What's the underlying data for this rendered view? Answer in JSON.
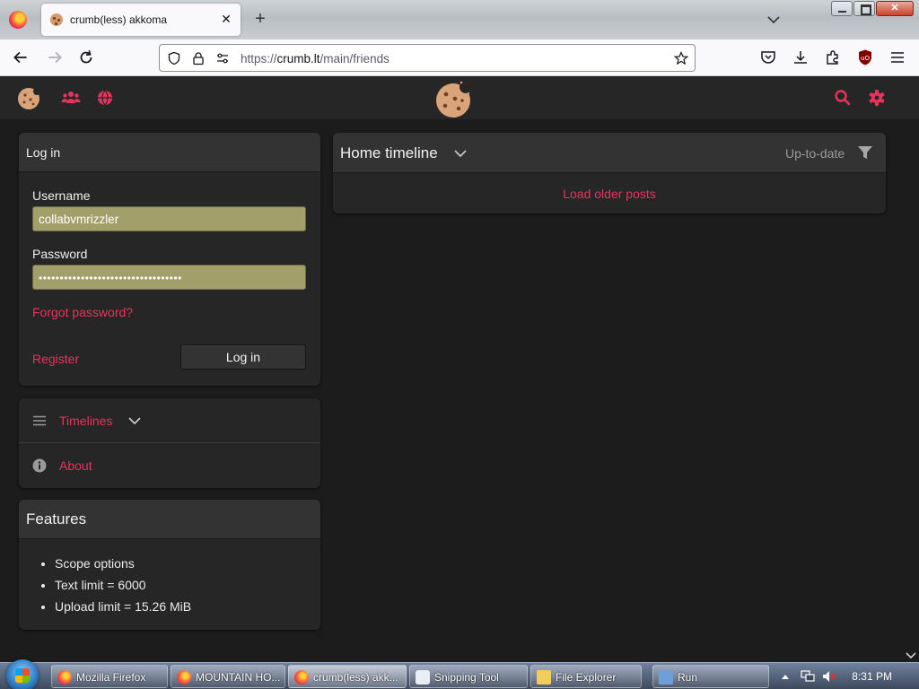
{
  "browser": {
    "tab_title": "crumb(less) akkoma",
    "url_prefix": "https://",
    "url_host": "crumb.lt",
    "url_path": "/main/friends"
  },
  "colors": {
    "accent": "#e8335d",
    "panel_bg": "#262626",
    "page_bg": "#1c1c1c",
    "field_bg": "#a39f6a"
  },
  "login": {
    "header": "Log in",
    "username_label": "Username",
    "username_value": "collabvmrizzler",
    "password_label": "Password",
    "password_value": "••••••••••••••••••••••••••••••••••",
    "forgot_link": "Forgot password?",
    "register_link": "Register",
    "login_button": "Log in"
  },
  "nav": {
    "timelines": "Timelines",
    "about": "About"
  },
  "features": {
    "title": "Features",
    "items": [
      "Scope options",
      "Text limit = 6000",
      "Upload limit = 15.26 MiB"
    ]
  },
  "timeline": {
    "title": "Home timeline",
    "status": "Up-to-date",
    "load_older": "Load older posts"
  },
  "taskbar": {
    "items": [
      "Mozilla Firefox",
      "MOUNTAIN HO...",
      "crumb(less) akk...",
      "Snipping Tool",
      "File Explorer",
      "Run"
    ],
    "clock": "8:31 PM"
  }
}
